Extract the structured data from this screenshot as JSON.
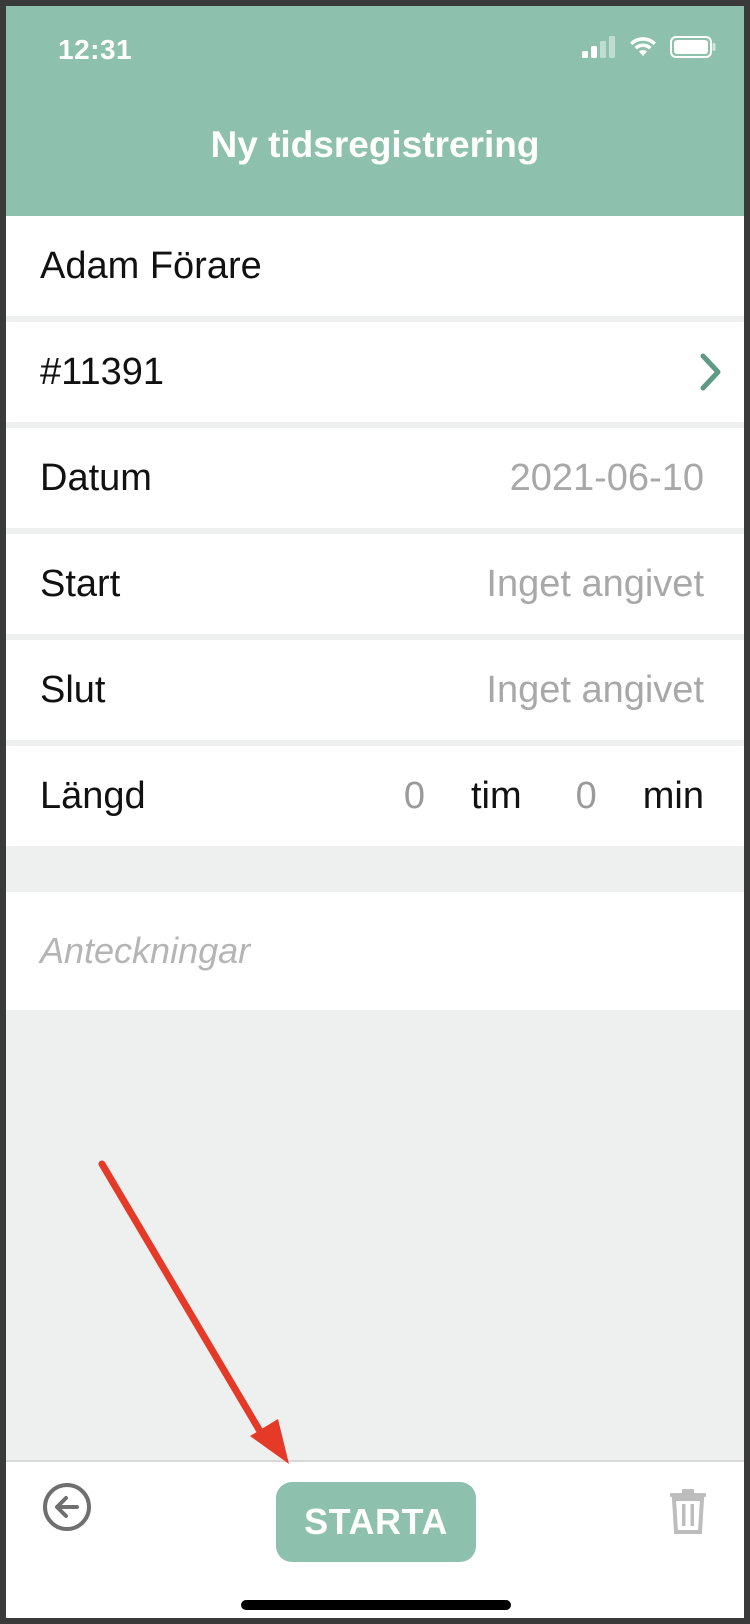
{
  "status_bar": {
    "time": "12:31",
    "icons": [
      "signal-icon",
      "wifi-icon",
      "battery-icon"
    ]
  },
  "header": {
    "title": "Ny tidsregistrering",
    "color": "#8dc1ad"
  },
  "form": {
    "driver": "Adam Förare",
    "order": "#11391",
    "date_label": "Datum",
    "date_value": "2021-06-10",
    "start_label": "Start",
    "start_value": "Inget angivet",
    "end_label": "Slut",
    "end_value": "Inget angivet",
    "length_label": "Längd",
    "length_hours": "0",
    "length_hours_unit": "tim",
    "length_minutes": "0",
    "length_minutes_unit": "min",
    "notes_placeholder": "Anteckningar"
  },
  "bottom_bar": {
    "start_label": "STARTA",
    "icons": [
      "back-arrow-icon",
      "trash-icon"
    ]
  },
  "colors": {
    "accent": "#8dc1ad",
    "annotation": "#e53a27"
  }
}
